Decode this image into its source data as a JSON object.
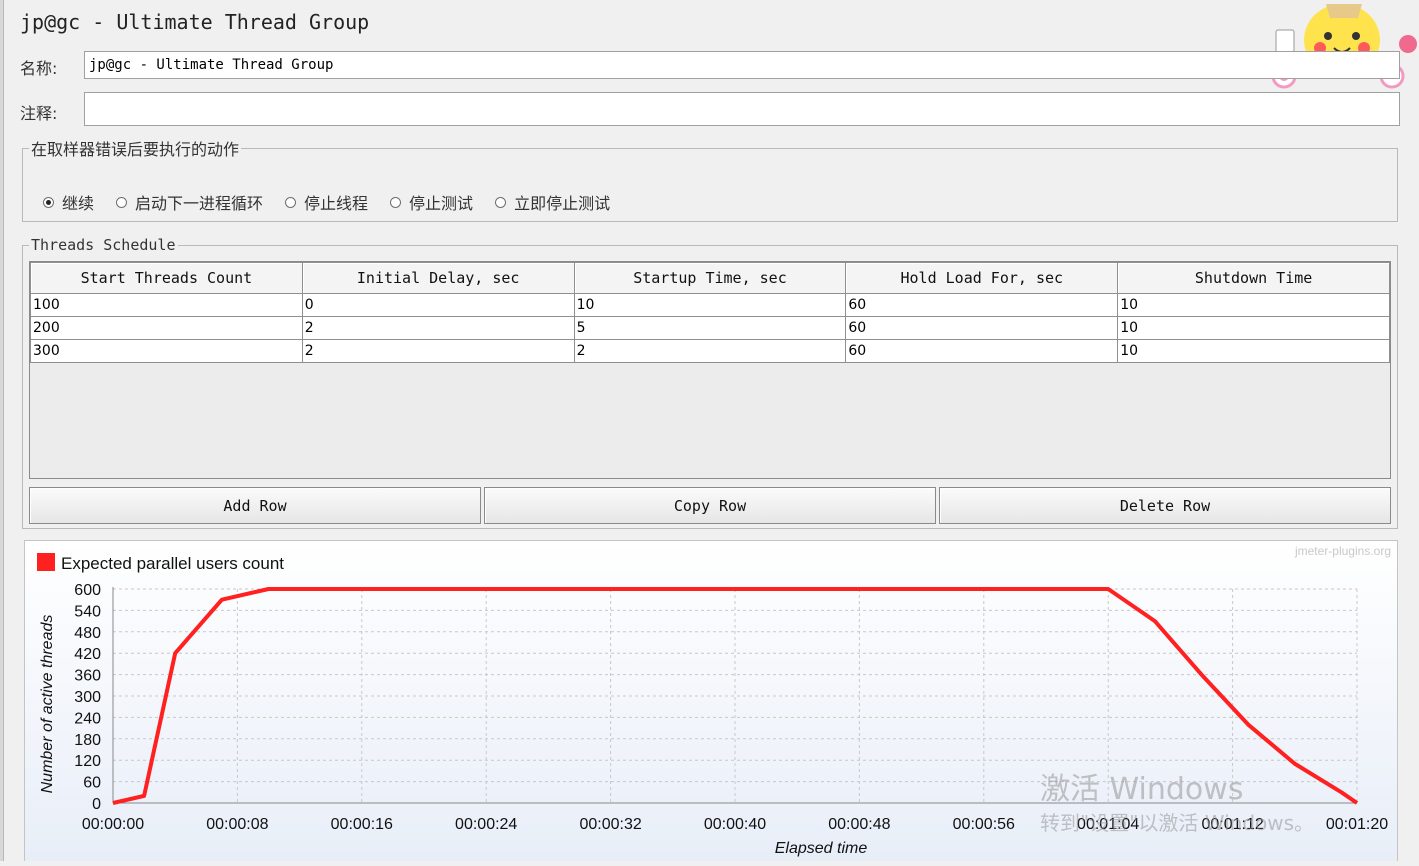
{
  "window": {
    "title": "jp@gc - Ultimate Thread Group"
  },
  "form": {
    "name_label": "名称:",
    "name_value": "jp@gc - Ultimate Thread Group",
    "comment_label": "注释:",
    "comment_value": ""
  },
  "sampler_error": {
    "legend": "在取样器错误后要执行的动作",
    "options": [
      {
        "label": "继续",
        "checked": true
      },
      {
        "label": "启动下一进程循环",
        "checked": false
      },
      {
        "label": "停止线程",
        "checked": false
      },
      {
        "label": "停止测试",
        "checked": false
      },
      {
        "label": "立即停止测试",
        "checked": false
      }
    ]
  },
  "schedule": {
    "legend": "Threads Schedule",
    "columns": [
      "Start Threads Count",
      "Initial Delay, sec",
      "Startup Time, sec",
      "Hold Load For, sec",
      "Shutdown Time"
    ],
    "rows": [
      [
        "100",
        "0",
        "10",
        "60",
        "10"
      ],
      [
        "200",
        "2",
        "5",
        "60",
        "10"
      ],
      [
        "300",
        "2",
        "2",
        "60",
        "10"
      ]
    ],
    "buttons": {
      "add": "Add Row",
      "copy": "Copy Row",
      "delete": "Delete Row"
    }
  },
  "chart_data": {
    "type": "line",
    "credit": "jmeter-plugins.org",
    "xlabel": "Elapsed time",
    "ylabel": "Number of active threads",
    "ylim": [
      0,
      600
    ],
    "xlim": [
      0,
      80
    ],
    "yticks": [
      0,
      60,
      120,
      180,
      240,
      300,
      360,
      420,
      480,
      540,
      600
    ],
    "xticks": [
      "00:00:00",
      "00:00:08",
      "00:00:16",
      "00:00:24",
      "00:00:32",
      "00:00:40",
      "00:00:48",
      "00:00:56",
      "00:01:04",
      "00:01:12",
      "00:01:20"
    ],
    "grid": true,
    "legend_position": "top-left",
    "series": [
      {
        "name": "Expected parallel users count",
        "color": "#ff2020",
        "x": [
          0,
          2,
          4,
          7,
          10,
          64,
          67,
          70,
          73,
          76,
          79,
          80
        ],
        "y": [
          0,
          20,
          420,
          570,
          600,
          600,
          510,
          360,
          220,
          110,
          30,
          0
        ]
      }
    ]
  },
  "watermark": {
    "line1": "激活 Windows",
    "line2": "转到\"设置\"以激活 Windows。"
  }
}
